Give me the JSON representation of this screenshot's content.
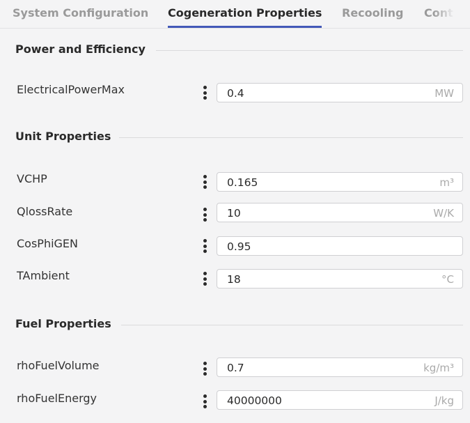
{
  "tabs": [
    {
      "label": "System Configuration"
    },
    {
      "label": "Cogeneration Properties"
    },
    {
      "label": "Recooling"
    },
    {
      "label": "Cont"
    }
  ],
  "sections": [
    {
      "title": "Power and Efficiency",
      "fields": [
        {
          "label": "ElectricalPowerMax",
          "value": "0.4",
          "unit": "MW"
        }
      ]
    },
    {
      "title": "Unit Properties",
      "fields": [
        {
          "label": "VCHP",
          "value": "0.165",
          "unit": "m³"
        },
        {
          "label": "QlossRate",
          "value": "10",
          "unit": "W/K"
        },
        {
          "label": "CosPhiGEN",
          "value": "0.95",
          "unit": ""
        },
        {
          "label": "TAmbient",
          "value": "18",
          "unit": "°C"
        }
      ]
    },
    {
      "title": "Fuel Properties",
      "fields": [
        {
          "label": "rhoFuelVolume",
          "value": "0.7",
          "unit": "kg/m³"
        },
        {
          "label": "rhoFuelEnergy",
          "value": "40000000",
          "unit": "J/kg"
        }
      ]
    }
  ],
  "icons": {
    "field_menu": "kebab-menu-icon"
  },
  "colors": {
    "active_tab_underline": "#4359b8",
    "background": "#f4f4f5"
  }
}
